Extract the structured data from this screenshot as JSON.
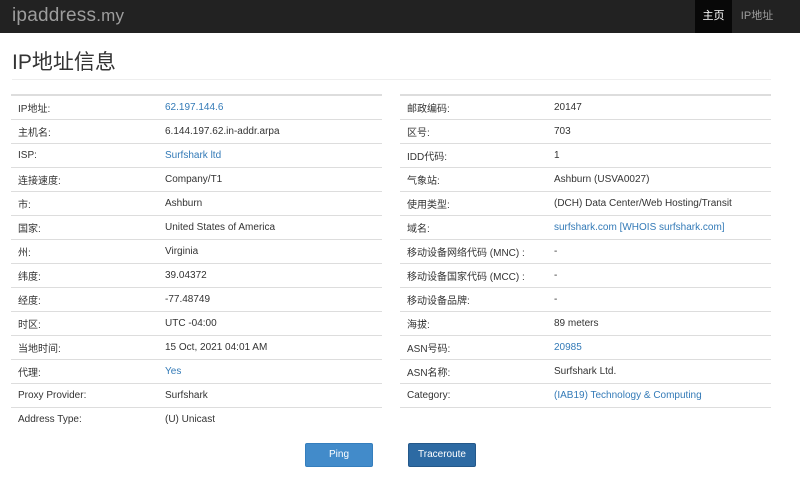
{
  "navbar": {
    "brand_name": "ipaddress",
    "brand_tld": ".my",
    "items": [
      {
        "label": "主页",
        "active": true
      },
      {
        "label": "IP地址",
        "active": false
      }
    ]
  },
  "page_title": "IP地址信息",
  "left_rows": [
    {
      "label": "IP地址:",
      "value": "62.197.144.6",
      "link": true
    },
    {
      "label": "主机名:",
      "value": "6.144.197.62.in-addr.arpa",
      "link": false
    },
    {
      "label": "ISP:",
      "value": "Surfshark ltd",
      "link": true
    },
    {
      "label": "连接速度:",
      "value": "Company/T1",
      "link": false
    },
    {
      "label": "市:",
      "value": "Ashburn",
      "link": false
    },
    {
      "label": "国家:",
      "value": "United States of America",
      "link": false
    },
    {
      "label": "州:",
      "value": "Virginia",
      "link": false
    },
    {
      "label": "纬度:",
      "value": "39.04372",
      "link": false
    },
    {
      "label": "经度:",
      "value": "-77.48749",
      "link": false
    },
    {
      "label": "时区:",
      "value": "UTC -04:00",
      "link": false
    },
    {
      "label": "当地时间:",
      "value": "15 Oct, 2021 04:01 AM",
      "link": false
    },
    {
      "label": "代理:",
      "value": "Yes",
      "link": true
    },
    {
      "label": "Proxy Provider:",
      "value": "Surfshark",
      "link": false
    },
    {
      "label": "Address Type:",
      "value": "(U) Unicast",
      "link": false
    }
  ],
  "right_rows": [
    {
      "label": "邮政编码:",
      "value": "20147",
      "link": false
    },
    {
      "label": "区号:",
      "value": "703",
      "link": false
    },
    {
      "label": "IDD代码:",
      "value": "1",
      "link": false
    },
    {
      "label": "气象站:",
      "value": "Ashburn (USVA0027)",
      "link": false
    },
    {
      "label": "使用类型:",
      "value": "(DCH) Data Center/Web Hosting/Transit",
      "link": false
    },
    {
      "label": "域名:",
      "value": "surfshark.com [WHOIS surfshark.com]",
      "link": true
    },
    {
      "label": "移动设备网络代码 (MNC) :",
      "value": "-",
      "link": false
    },
    {
      "label": "移动设备国家代码 (MCC) :",
      "value": "-",
      "link": false
    },
    {
      "label": "移动设备品牌:",
      "value": "-",
      "link": false
    },
    {
      "label": "海拔:",
      "value": "89 meters",
      "link": false
    },
    {
      "label": "ASN号码:",
      "value": "20985",
      "link": true
    },
    {
      "label": "ASN名称:",
      "value": "Surfshark Ltd.",
      "link": false
    },
    {
      "label": "Category:",
      "value": "(IAB19) Technology & Computing",
      "link": true
    }
  ],
  "buttons": {
    "ping_label": "Ping",
    "traceroute_label": "Traceroute"
  },
  "colors": {
    "navbar_bg": "#222222",
    "link": "#337ab7",
    "ping_button": "#428bca",
    "traceroute_button": "#2d6aa3"
  }
}
